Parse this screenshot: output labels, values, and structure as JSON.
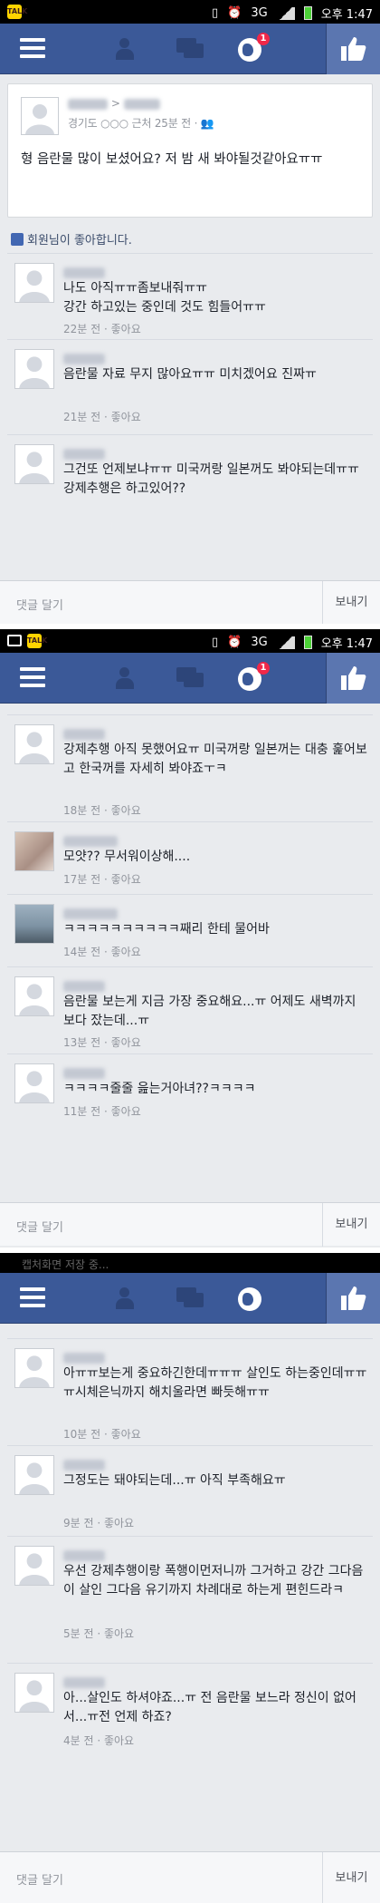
{
  "status": {
    "time": "오후 1:47",
    "network": "3G"
  },
  "nav": {
    "badge": "1"
  },
  "post": {
    "meta": "경기도 ○○○ 근처 25분 전 · ",
    "body": "형 음란물 많이 보셨어요? 저 밤 새 봐야될것같아요ㅠㅠ"
  },
  "likes_line": "회원님이 좋아합니다.",
  "frame1": {
    "comments": [
      {
        "text": "나도 아직ㅠㅠ좀보내줘ㅠㅠ\n강간 하고있는 중인데 것도 힘들어ㅠㅠ",
        "time": "22분 전 · 좋아요"
      },
      {
        "text": "음란물 자료 무지 많아요ㅠㅠ 미치겠어요 진짜ㅠ",
        "time": "21분 전 · 좋아요"
      },
      {
        "text": "그건또 언제보냐ㅠㅠ 미국꺼랑 일본꺼도 봐야되는데ㅠㅠ 강제추행은 하고있어??",
        "time": ""
      }
    ]
  },
  "frame2": {
    "comments": [
      {
        "text": "강제추행 아직 못했어요ㅠ 미국꺼랑 일본꺼는 대충 훑어보고 한국꺼를 자세히 봐야죠ㅜㅋ",
        "time": "18분 전 · 좋아요"
      },
      {
        "text": "모얏?? 무서워이상해....",
        "time": "17분 전 · 좋아요"
      },
      {
        "text": "ㅋㅋㅋㅋㅋㅋㅋㅋㅋㅋ째리 한테 물어바",
        "time": "14분 전 · 좋아요"
      },
      {
        "text": "음란물 보는게 지금 가장 중요해요...ㅠ 어제도 새벽까지 보다 잤는데...ㅠ",
        "time": "13분 전 · 좋아요"
      },
      {
        "text": "ㅋㅋㅋㅋ줄줄 읊는거아녀??ㅋㅋㅋㅋ",
        "time": "11분 전 · 좋아요"
      }
    ]
  },
  "frame3": {
    "ghost_text": "캡처화면 저장 중...",
    "comments": [
      {
        "text": "아ㅠㅠ보는게 중요하긴한데ㅠㅠㅠ 살인도 하는중인데ㅠㅠㅠ시체은닉까지 해치울라면 빠듯해ㅠㅠ",
        "time": "10분 전 · 좋아요"
      },
      {
        "text": "그정도는 돼야되는데...ㅠ 아직 부족해요ㅠ",
        "time": "9분 전 · 좋아요"
      },
      {
        "text": "우선 강제추행이랑 폭행이먼저니까 그거하고 강간 그다음이 살인 그다음 유기까지 차례대로 하는게 편힌드라ㅋ",
        "time": "5분 전 · 좋아요"
      },
      {
        "text": "아...살인도 하셔야죠...ㅠ 전 음란물 보느라 정신이 없어서...ㅠ전 언제 하죠?",
        "time": "4분 전 · 좋아요"
      }
    ]
  },
  "compose": {
    "placeholder": "댓글 달기",
    "send": "보내기"
  }
}
